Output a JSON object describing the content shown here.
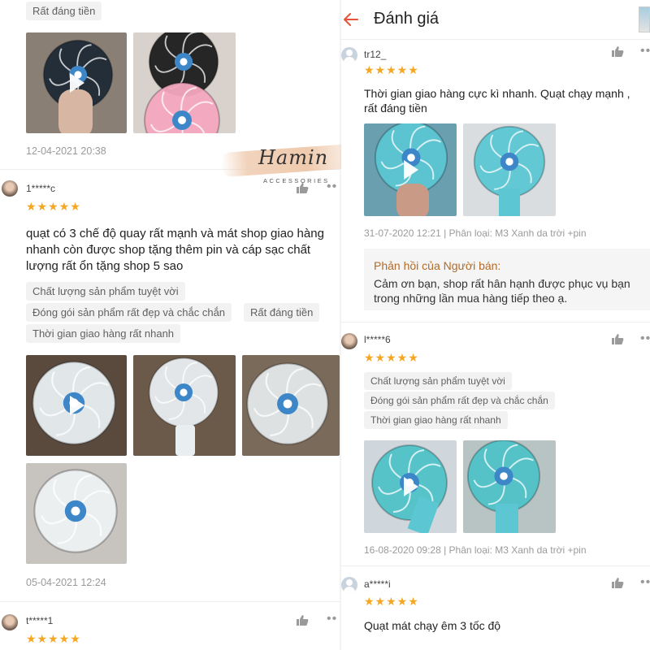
{
  "header": {
    "title": "Đánh giá"
  },
  "brand": {
    "script": "Hamin",
    "sub": "ACCESSORIES"
  },
  "left": {
    "top_tag": "Rất đáng tiền",
    "review0": {
      "date": "12-04-2021 20:38"
    },
    "review1": {
      "user": "1*****c",
      "stars": "★★★★★",
      "comment": "quạt có 3 chế độ quay rất mạnh và mát shop giao hàng nhanh còn được shop tặng thêm pin và cáp sạc chất lượng rất ổn tặng shop 5 sao",
      "tags": [
        "Chất lượng sản phẩm tuyệt vời",
        "Đóng gói sản phẩm rất đẹp và chắc chắn",
        "Rất đáng tiền",
        "Thời gian giao hàng rất nhanh"
      ],
      "date": "05-04-2021 12:24"
    },
    "review2": {
      "user": "t*****1",
      "stars": "★★★★★"
    }
  },
  "right": {
    "review1": {
      "user": "tr12_",
      "stars": "★★★★★",
      "comment": "Thời gian giao hàng cực kì nhanh. Quạt chạy mạnh , rất đáng tiền",
      "meta": "31-07-2020 12:21 | Phân loại: M3 Xanh da trời +pin",
      "reply_title": "Phản hồi của Người bán:",
      "reply_body": "Cảm ơn bạn, shop rất hân hạnh được phục vụ bạn trong những lần mua hàng tiếp theo ạ."
    },
    "review2": {
      "user": "l*****6",
      "stars": "★★★★★",
      "tags": [
        "Chất lượng sản phẩm tuyệt vời",
        "Đóng gói sản phẩm rất đẹp và chắc chắn",
        "Thời gian giao hàng rất nhanh"
      ],
      "meta": "16-08-2020 09:28 | Phân loại: M3 Xanh da trời +pin"
    },
    "review3": {
      "user": "a*****i",
      "stars": "★★★★★",
      "comment": "Quạt mát chạy êm 3 tốc độ"
    }
  },
  "icons": {
    "like": "thumbs-up-icon",
    "more": "more-dots-icon",
    "back": "arrow-left-icon",
    "play": "play-icon",
    "avatar": "avatar-icon"
  },
  "colors": {
    "star": "#f5a623",
    "back_arrow": "#e5533a",
    "reply_title": "#b26a26",
    "tag_bg": "#f2f2f2",
    "fan_blue": "#5cc6d2",
    "fan_white": "#e9eef1",
    "fan_pink": "#f4a8bf"
  }
}
